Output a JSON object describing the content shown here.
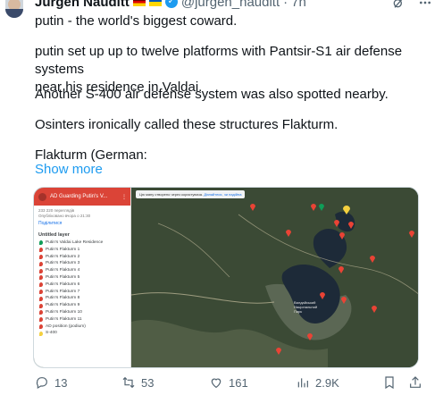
{
  "author": {
    "name": "Jürgen Nauditt",
    "handle": "@jurgen_nauditt",
    "separator": "·",
    "time": "7h"
  },
  "tweet": {
    "line1": "putin - the world's biggest coward.",
    "line2": "putin set up up to twelve platforms with Pantsir-S1 air defense systems\nnear his residence in Valdai.",
    "line3": "Another S-400 air defense system was also spotted nearby.",
    "line4": "Osinters ironically called these structures Flakturm.",
    "line5": "Flakturm (German:",
    "show_more": "Show more"
  },
  "media": {
    "map_title": "AD Guarding Putin's V...",
    "meta_line1": "233 220 переглядів",
    "meta_line2": "Опубліковано вчора о 21:30",
    "share": "Поділитися",
    "layer": "Untitled layer",
    "notice": "Цю мапу створено через користувача.",
    "notice_link": "Дізнайтеся, чи надійна",
    "items": [
      {
        "label": "Putin's Valdai Lake Residence",
        "color": "green"
      },
      {
        "label": "Putin's Flakturm 1",
        "color": "red"
      },
      {
        "label": "Putin's Flakturm 2",
        "color": "red"
      },
      {
        "label": "Putin's Flakturm 3",
        "color": "red"
      },
      {
        "label": "Putin's Flakturm 4",
        "color": "red"
      },
      {
        "label": "Putin's Flakturm 5",
        "color": "red"
      },
      {
        "label": "Putin's Flakturm 6",
        "color": "red"
      },
      {
        "label": "Putin's Flakturm 7",
        "color": "red"
      },
      {
        "label": "Putin's Flakturm 8",
        "color": "red"
      },
      {
        "label": "Putin's Flakturm 9",
        "color": "red"
      },
      {
        "label": "Putin's Flakturm 10",
        "color": "red"
      },
      {
        "label": "Putin's Flakturm 11",
        "color": "red"
      },
      {
        "label": "AD position (podium)",
        "color": "red"
      },
      {
        "label": "S-400",
        "color": "yellow"
      }
    ],
    "place_labels": [
      "Валдайський",
      "Національний",
      "Парк"
    ]
  },
  "actions": {
    "replies": "13",
    "reposts": "53",
    "likes": "161",
    "views": "2.9K"
  },
  "colors": {
    "accent": "#1d9bf0",
    "muted": "#536471",
    "map_header": "#db4437"
  }
}
